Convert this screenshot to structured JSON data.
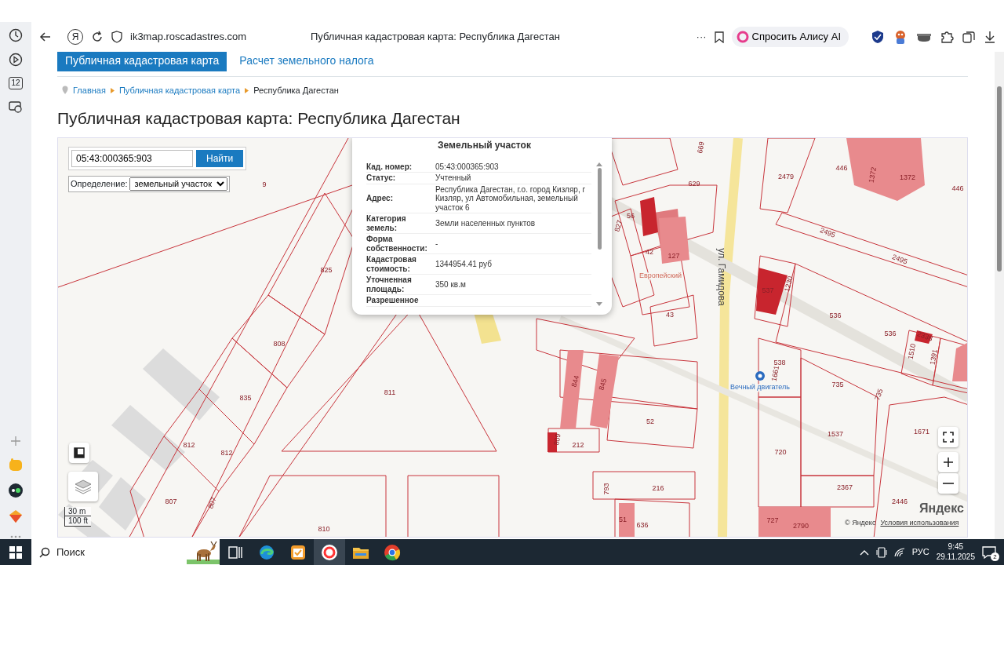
{
  "browser": {
    "sidebar_calendar": "12",
    "home_glyph": "Я",
    "address": "ik3map.roscadastres.com",
    "page_title": "Публичная кадастровая карта: Республика Дагестан",
    "menu_glyph": "···",
    "alice_button": "Спросить Алису AI"
  },
  "page": {
    "tabs": [
      {
        "label": "Публичная кадастровая карта",
        "selected": true
      },
      {
        "label": "Расчет земельного налога",
        "selected": false
      }
    ],
    "breadcrumb": [
      "Главная",
      "Публичная кадастровая карта",
      "Республика Дагестан"
    ],
    "heading": "Публичная кадастровая карта: Республика Дагестан"
  },
  "map": {
    "search": {
      "value": "05:43:000365:903",
      "button": "Найти"
    },
    "definition": {
      "label": "Определение:",
      "value": "земельный участок"
    },
    "popup": {
      "title": "Земельный участок",
      "rows": [
        {
          "label": "Кад. номер:",
          "value": "05:43:000365:903"
        },
        {
          "label": "Статус:",
          "value": "Учтенный"
        },
        {
          "label": "Адрес:",
          "value": "Республика Дагестан, г.о. город Кизляр, г Кизляр, ул Автомобильная, земельный участок 6"
        },
        {
          "label": "Категория земель:",
          "value": "Земли населенных пунктов"
        },
        {
          "label": "Форма собственности:",
          "value": "-"
        },
        {
          "label": "Кадастровая стоимость:",
          "value": "1344954.41 руб"
        },
        {
          "label": "Уточненная площадь:",
          "value": "350 кв.м"
        },
        {
          "label": "Разрешенное",
          "value": ""
        }
      ]
    },
    "parcel_numbers": [
      "9",
      "825",
      "808",
      "835",
      "811",
      "812",
      "812",
      "807",
      "807",
      "810",
      "669",
      "629",
      "56",
      "827",
      "42",
      "127",
      "43",
      "2479",
      "446",
      "1372",
      "1372",
      "446",
      "2495",
      "2495",
      "537",
      "1230",
      "536",
      "536",
      "2338",
      "1510",
      "1391",
      "538",
      "1661",
      "735",
      "735",
      "844",
      "845",
      "52",
      "809",
      "212",
      "793",
      "216",
      "51",
      "636",
      "720",
      "1537",
      "2367",
      "1671",
      "2446",
      "727",
      "2790"
    ],
    "street_label": "ул. Гамидова",
    "poi_labels": [
      "Европейский",
      "Вечный двигатель"
    ],
    "scale": [
      "30 m",
      "100 ft"
    ],
    "copyright": "© Яндекс",
    "terms_link": "Условия использования",
    "logo": "Яндекс"
  },
  "taskbar": {
    "search_placeholder": "Поиск",
    "language": "РУС",
    "time": "9:45",
    "date": "29.11.2025",
    "notifications": "2"
  }
}
